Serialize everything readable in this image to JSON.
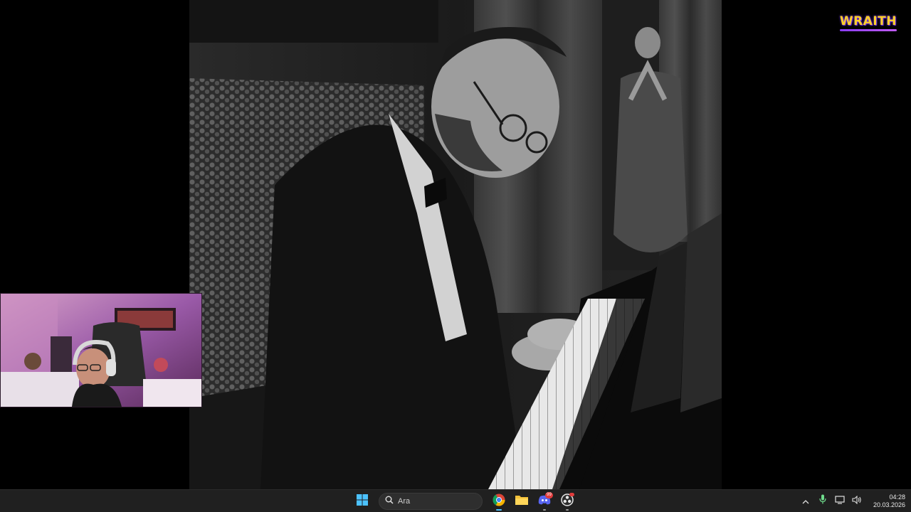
{
  "viewer": {
    "brand": {
      "text": "WRAITH"
    }
  },
  "taskbar": {
    "search": {
      "placeholder": "Ara"
    },
    "apps": [
      {
        "name": "windows-start",
        "icon": "windows-logo-icon"
      },
      {
        "name": "chrome",
        "icon": "chrome-icon"
      },
      {
        "name": "file-explorer",
        "icon": "folder-icon"
      },
      {
        "name": "discord",
        "icon": "discord-icon",
        "badge": "99"
      },
      {
        "name": "obs",
        "icon": "obs-icon"
      }
    ],
    "tray": {
      "time": "04:28",
      "date": "20.03.2026"
    }
  },
  "colors": {
    "taskbar_bg": "#202020",
    "brand_yellow": "#ffd12a",
    "brand_purple": "#8a3cff",
    "accent_blue": "#4cc2ff"
  }
}
